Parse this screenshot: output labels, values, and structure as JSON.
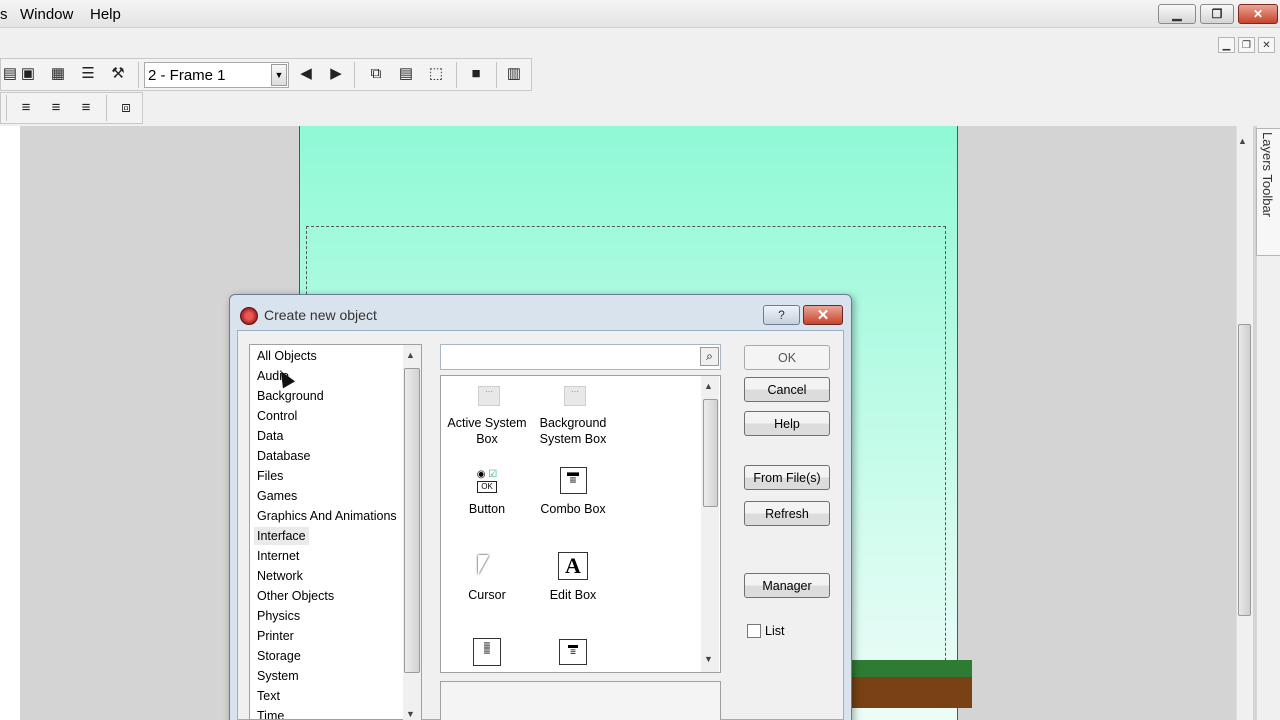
{
  "menubar": {
    "items": [
      "s",
      "Window",
      "Help"
    ]
  },
  "toolbar": {
    "frame_value": "2 - Frame 1"
  },
  "layers_toolbar": {
    "label": "Layers Toolbar"
  },
  "dialog": {
    "title": "Create new object",
    "categories": [
      "All Objects",
      "Audio",
      "Background",
      "Control",
      "Data",
      "Database",
      "Files",
      "Games",
      "Graphics And Animations",
      "Interface",
      "Internet",
      "Network",
      "Other Objects",
      "Physics",
      "Printer",
      "Storage",
      "System",
      "Text",
      "Time"
    ],
    "selected_category": "Interface",
    "search_value": "",
    "objects": [
      {
        "label1": "Active System",
        "label2": "Box",
        "icon": "active-system-box-icon"
      },
      {
        "label1": "Background",
        "label2": "System Box",
        "icon": "background-system-box-icon"
      },
      {
        "label1": "Button",
        "label2": "",
        "icon": "button-object-icon"
      },
      {
        "label1": "Combo Box",
        "label2": "",
        "icon": "combo-box-icon"
      },
      {
        "label1": "Cursor",
        "label2": "",
        "icon": "cursor-object-icon"
      },
      {
        "label1": "Edit Box",
        "label2": "",
        "icon": "edit-box-icon"
      }
    ],
    "buttons": {
      "ok": "OK",
      "cancel": "Cancel",
      "help": "Help",
      "from_files": "From File(s)",
      "refresh": "Refresh",
      "manager": "Manager"
    },
    "list_label": "List",
    "list_checked": false
  }
}
